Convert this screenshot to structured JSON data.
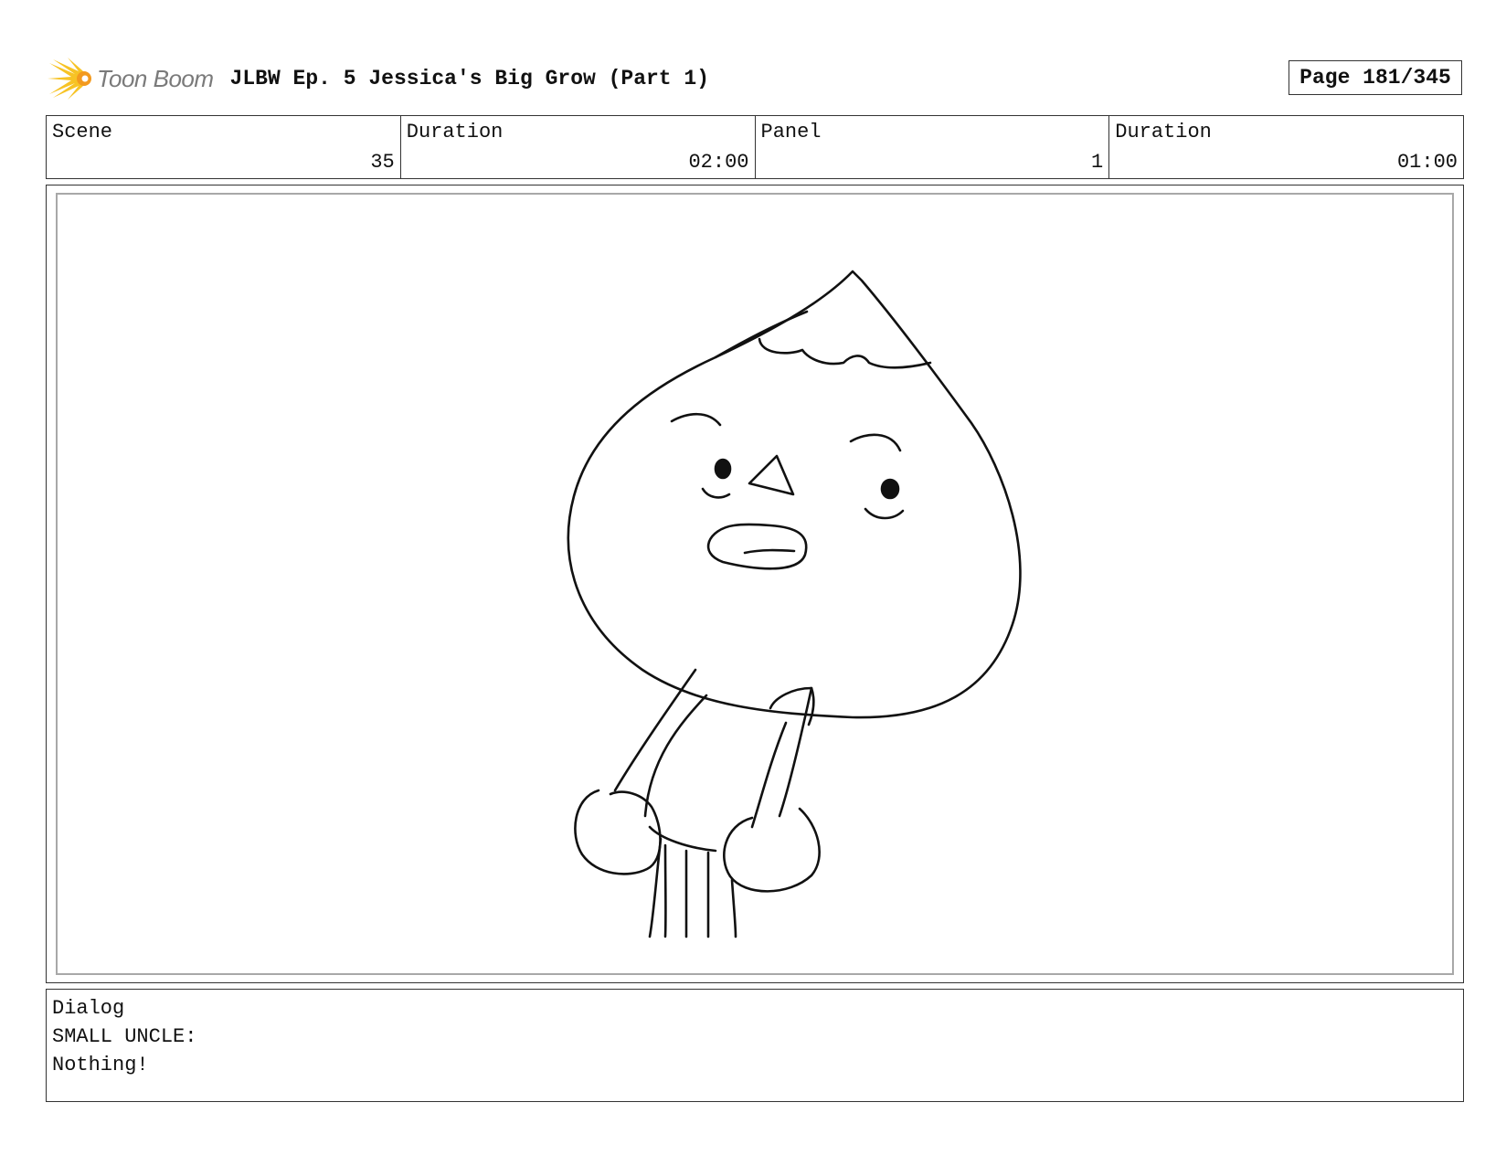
{
  "header": {
    "logo_text": "Toon Boom",
    "title": "JLBW Ep. 5 Jessica's Big Grow (Part 1)",
    "page": "Page 181/345"
  },
  "info": {
    "scene_label": "Scene",
    "scene_value": "35",
    "scene_duration_label": "Duration",
    "scene_duration_value": "02:00",
    "panel_label": "Panel",
    "panel_value": "1",
    "panel_duration_label": "Duration",
    "panel_duration_value": "01:00"
  },
  "dialog": {
    "label": "Dialog",
    "speaker": "SMALL UNCLE:",
    "line": "Nothing!"
  },
  "colors": {
    "logo_yellow": "#f7c325",
    "logo_orange": "#f39a1e",
    "logo_text": "#7a7a7a",
    "frame_border": "#a8a8a8"
  }
}
